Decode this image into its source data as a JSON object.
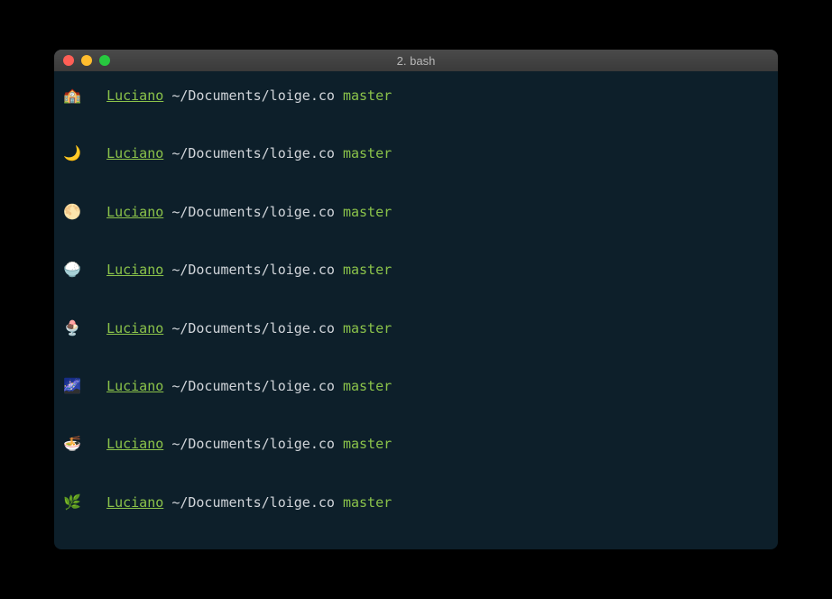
{
  "titlebar": {
    "title": "2. bash"
  },
  "prompts": [
    {
      "emoji": "🏫",
      "username": "Luciano",
      "path": "~/Documents/loige.co",
      "branch": "master"
    },
    {
      "emoji": "🌙",
      "username": "Luciano",
      "path": "~/Documents/loige.co",
      "branch": "master"
    },
    {
      "emoji": "🌕",
      "username": "Luciano",
      "path": "~/Documents/loige.co",
      "branch": "master"
    },
    {
      "emoji": "🍚",
      "username": "Luciano",
      "path": "~/Documents/loige.co",
      "branch": "master"
    },
    {
      "emoji": "🍨",
      "username": "Luciano",
      "path": "~/Documents/loige.co",
      "branch": "master"
    },
    {
      "emoji": "🌌",
      "username": "Luciano",
      "path": "~/Documents/loige.co",
      "branch": "master"
    },
    {
      "emoji": "🍜",
      "username": "Luciano",
      "path": "~/Documents/loige.co",
      "branch": "master"
    },
    {
      "emoji": "🌿",
      "username": "Luciano",
      "path": "~/Documents/loige.co",
      "branch": "master"
    }
  ]
}
